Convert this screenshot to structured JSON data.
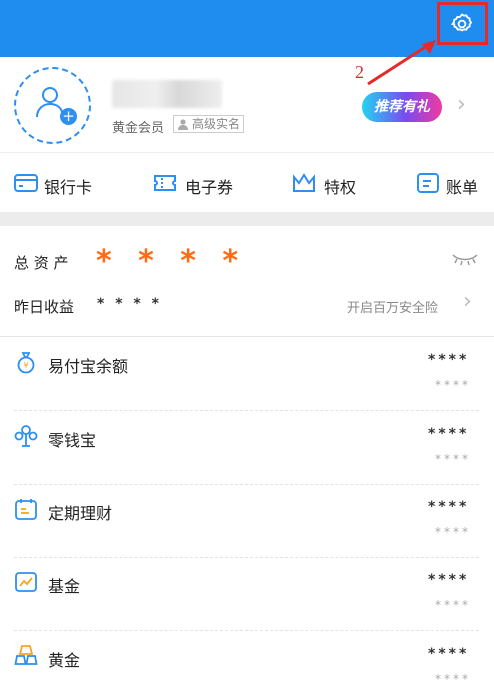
{
  "profile": {
    "member_level": "黄金会员",
    "verify_label": "高级实名",
    "promo_badge": "推荐有礼"
  },
  "annotation": {
    "step_number": "2",
    "color": "#e42a2a"
  },
  "quick_links": [
    {
      "label": "银行卡",
      "icon": "card-icon"
    },
    {
      "label": "电子券",
      "icon": "ticket-icon"
    },
    {
      "label": "特权",
      "icon": "crown-icon"
    },
    {
      "label": "账单",
      "icon": "bill-icon"
    }
  ],
  "assets": {
    "total_label": "总 资 产",
    "total_value": "* * * *",
    "yesterday_label": "昨日收益",
    "yesterday_value": "* * * *",
    "insurance_hint": "开启百万安全险"
  },
  "products": [
    {
      "name": "易付宝余额",
      "icon": "money-bag-icon",
      "value": "****",
      "sub_value": "****"
    },
    {
      "name": "零钱宝",
      "icon": "coin-tree-icon",
      "value": "****",
      "sub_value": "****"
    },
    {
      "name": "定期理财",
      "icon": "calendar-icon",
      "value": "****",
      "sub_value": "****"
    },
    {
      "name": "基金",
      "icon": "fund-chart-icon",
      "value": "****",
      "sub_value": "****"
    },
    {
      "name": "黄金",
      "icon": "gold-bars-icon",
      "value": "****",
      "sub_value": "****"
    }
  ],
  "colors": {
    "header": "#1f8cf0",
    "accent": "#2e8ff0",
    "asset_stars": "#ff6a13"
  }
}
